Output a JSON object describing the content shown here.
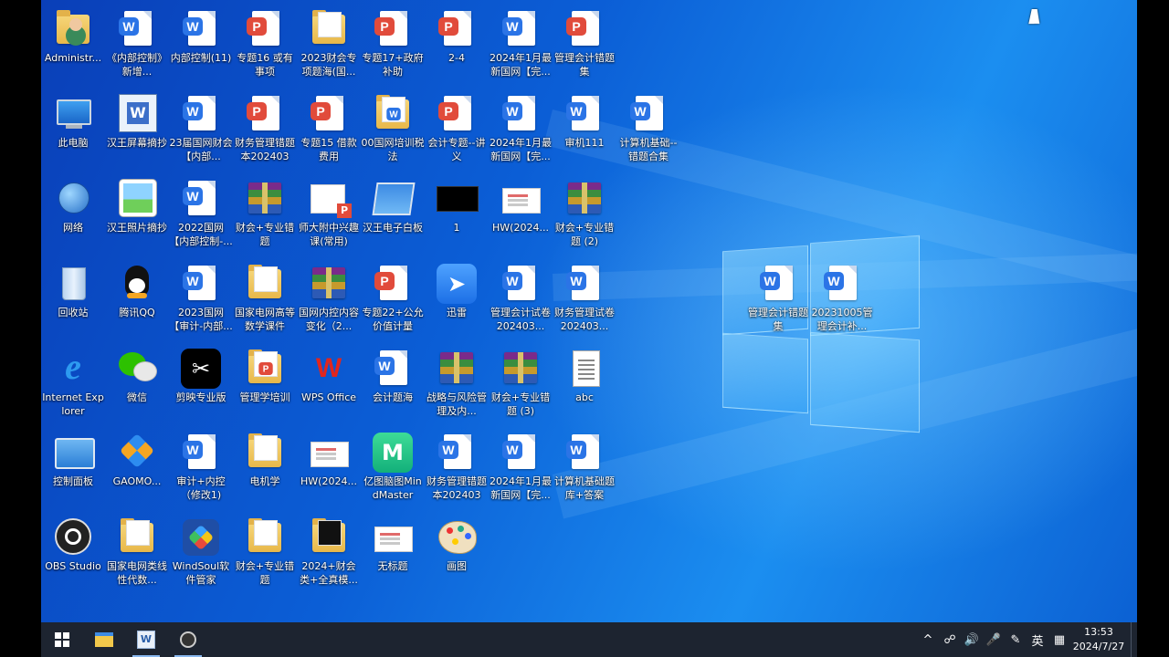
{
  "desktop": {
    "icons": [
      {
        "label": "Administr...",
        "type": "user-folder",
        "icon": "user-folder-icon"
      },
      {
        "label": "《内部控制》新增...",
        "type": "word",
        "icon": "word-document-icon"
      },
      {
        "label": "内部控制(11)",
        "type": "word",
        "icon": "word-document-icon"
      },
      {
        "label": "专题16 或有事项",
        "type": "pdf",
        "icon": "pdf-document-icon"
      },
      {
        "label": "2023财会专项题海(国...",
        "type": "folder",
        "icon": "folder-icon"
      },
      {
        "label": "专题17+政府补助",
        "type": "pdf",
        "icon": "pdf-document-icon"
      },
      {
        "label": "2-4",
        "type": "pdf",
        "icon": "pdf-document-icon"
      },
      {
        "label": "2024年1月最新国网【完...",
        "type": "word",
        "icon": "word-document-icon"
      },
      {
        "label": "管理会计错题集",
        "type": "pdf",
        "icon": "pdf-document-icon"
      },
      {
        "label": "此电脑",
        "type": "monitor",
        "icon": "this-pc-icon"
      },
      {
        "label": "汉王屏幕摘抄",
        "type": "screen-app",
        "icon": "hanwang-screen-icon"
      },
      {
        "label": "23届国网财会【内部...",
        "type": "word",
        "icon": "word-document-icon"
      },
      {
        "label": "财务管理错题本202403",
        "type": "pdf",
        "icon": "pdf-document-icon"
      },
      {
        "label": "专题15 借款费用",
        "type": "pdf",
        "icon": "pdf-document-icon"
      },
      {
        "label": "00国网培训税法",
        "type": "folder-word",
        "icon": "folder-icon"
      },
      {
        "label": "会计专题--讲义",
        "type": "pdf",
        "icon": "pdf-document-icon"
      },
      {
        "label": "2024年1月最新国网【完...",
        "type": "word",
        "icon": "word-document-icon"
      },
      {
        "label": "审机111",
        "type": "word",
        "icon": "word-document-icon"
      },
      {
        "label": "计算机基础--错题合集",
        "type": "word",
        "icon": "word-document-icon"
      },
      {
        "label": "网络",
        "type": "globe",
        "icon": "network-icon"
      },
      {
        "label": "汉王照片摘抄",
        "type": "photo",
        "icon": "hanwang-photo-icon"
      },
      {
        "label": "2022国网【内部控制-...",
        "type": "word",
        "icon": "word-document-icon"
      },
      {
        "label": "财会+专业错题",
        "type": "rar",
        "icon": "winrar-archive-icon"
      },
      {
        "label": "师大附中兴趣课(常用)",
        "type": "ppt-thumb",
        "icon": "presentation-icon"
      },
      {
        "label": "汉王电子白板",
        "type": "whiteboard",
        "icon": "whiteboard-icon"
      },
      {
        "label": "1",
        "type": "black",
        "icon": "image-file-icon"
      },
      {
        "label": "HW(2024...",
        "type": "thumb",
        "icon": "document-thumbnail-icon"
      },
      {
        "label": "财会+专业错题 (2)",
        "type": "rar",
        "icon": "winrar-archive-icon"
      },
      {
        "label": "回收站",
        "type": "bin",
        "icon": "recycle-bin-icon"
      },
      {
        "label": "腾讯QQ",
        "type": "qq",
        "icon": "qq-icon"
      },
      {
        "label": "2023国网【审计-内部...",
        "type": "word",
        "icon": "word-document-icon"
      },
      {
        "label": "国家电网高等数学课件",
        "type": "folder",
        "icon": "folder-icon"
      },
      {
        "label": "国网内控内容变化（2...",
        "type": "rar",
        "icon": "winrar-archive-icon"
      },
      {
        "label": "专题22+公允价值计量",
        "type": "pdf",
        "icon": "pdf-document-icon"
      },
      {
        "label": "迅雷",
        "type": "xunlei",
        "icon": "xunlei-icon"
      },
      {
        "label": "管理会计试卷202403...",
        "type": "word",
        "icon": "word-document-icon"
      },
      {
        "label": "财务管理试卷202403...",
        "type": "word",
        "icon": "word-document-icon"
      },
      {
        "label": "Internet Explorer",
        "type": "ie",
        "icon": "internet-explorer-icon"
      },
      {
        "label": "微信",
        "type": "wechat",
        "icon": "wechat-icon"
      },
      {
        "label": "剪映专业版",
        "type": "capcut",
        "icon": "capcut-icon"
      },
      {
        "label": "管理学培训",
        "type": "folder-pdf",
        "icon": "folder-icon"
      },
      {
        "label": "WPS Office",
        "type": "wps",
        "icon": "wps-office-icon"
      },
      {
        "label": "会计题海",
        "type": "word",
        "icon": "word-document-icon"
      },
      {
        "label": "战略与风险管理及内...",
        "type": "rar",
        "icon": "winrar-archive-icon"
      },
      {
        "label": "财会+专业错题 (3)",
        "type": "rar",
        "icon": "winrar-archive-icon"
      },
      {
        "label": "abc",
        "type": "txt",
        "icon": "text-file-icon"
      },
      {
        "label": "控制面板",
        "type": "ctrl",
        "icon": "control-panel-icon"
      },
      {
        "label": "GAOMO...",
        "type": "gaomo",
        "icon": "gaomo-icon"
      },
      {
        "label": "审计+内控（修改1)",
        "type": "word",
        "icon": "word-document-icon"
      },
      {
        "label": "电机学",
        "type": "folder",
        "icon": "folder-icon"
      },
      {
        "label": "HW(2024...",
        "type": "thumb",
        "icon": "document-thumbnail-icon"
      },
      {
        "label": "亿图脑图MindMaster",
        "type": "mindmaster",
        "icon": "mindmaster-icon"
      },
      {
        "label": "财务管理错题本202403",
        "type": "word",
        "icon": "word-document-icon"
      },
      {
        "label": "2024年1月最新国网【完...",
        "type": "word",
        "icon": "word-document-icon"
      },
      {
        "label": "计算机基础题库+答案",
        "type": "word",
        "icon": "word-document-icon"
      },
      {
        "label": "OBS Studio",
        "type": "obs",
        "icon": "obs-studio-icon"
      },
      {
        "label": "国家电网类线性代数...",
        "type": "folder",
        "icon": "folder-icon"
      },
      {
        "label": "WindSoul软件管家",
        "type": "windsoul",
        "icon": "windsoul-icon"
      },
      {
        "label": "财会+专业错题",
        "type": "folder",
        "icon": "folder-icon"
      },
      {
        "label": "2024+财会类+全真模...",
        "type": "folder-black",
        "icon": "folder-icon"
      },
      {
        "label": "无标题",
        "type": "thumb",
        "icon": "document-thumbnail-icon"
      },
      {
        "label": "画图",
        "type": "palette",
        "icon": "paint-icon"
      },
      {
        "label": "管理会计错题集",
        "type": "word",
        "icon": "word-document-icon"
      },
      {
        "label": "20231005管理会计补...",
        "type": "word",
        "icon": "word-document-icon"
      }
    ]
  },
  "taskbar": {
    "apps": [
      {
        "name": "start",
        "icon": "windows-start-icon"
      },
      {
        "name": "file-explorer",
        "icon": "file-explorer-icon"
      },
      {
        "name": "hanwang",
        "icon": "hanwang-screen-icon"
      },
      {
        "name": "obs",
        "icon": "obs-studio-icon"
      }
    ],
    "tray": {
      "ime_label": "英",
      "time": "13:53",
      "date": "2024/7/27"
    }
  }
}
